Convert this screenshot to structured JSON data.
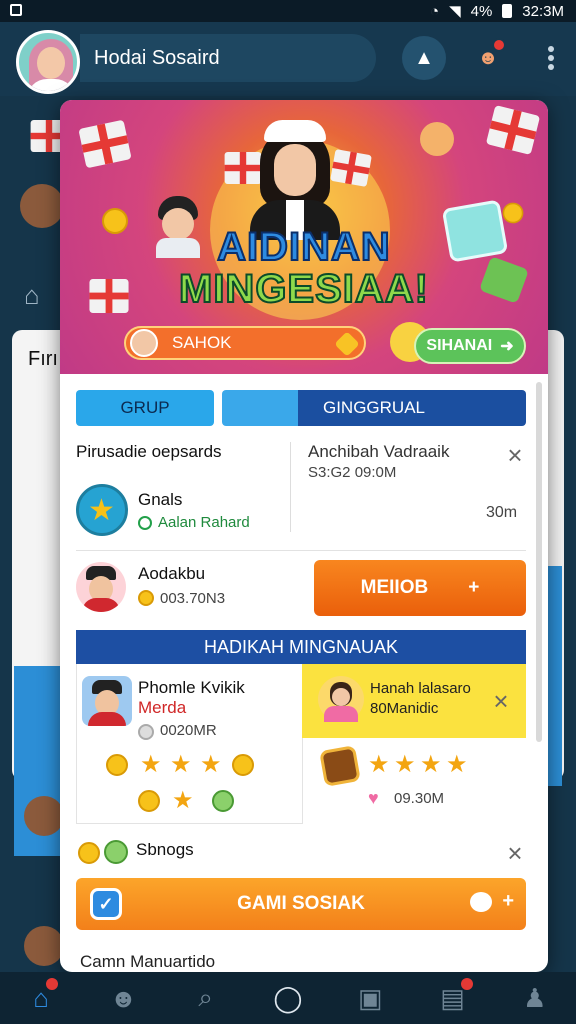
{
  "status_bar": {
    "battery": "4%",
    "time": "32:3M"
  },
  "header": {
    "username": "Hodai Sosaird"
  },
  "background": {
    "card_title": "Fırı"
  },
  "banner": {
    "title_line1": "AIDINAN",
    "title_line2": "MINGESIAA!",
    "pill_label": "SAHOK",
    "button_label": "SIHANAI"
  },
  "tabs": [
    {
      "label": "GRUP"
    },
    {
      "label": "GINGGRUAL"
    }
  ],
  "list": {
    "item1": {
      "title": "Pirusadie oepsards",
      "right_title": "Anchibah Vadraaik",
      "right_sub": "S3:G2 09:0M"
    },
    "item2": {
      "title": "Gnals",
      "sub": "Aalan Rahard",
      "time": "30m"
    },
    "item3": {
      "title": "Aodakbu",
      "sub": "003.70N3",
      "button_label": "MEIIOB",
      "button_icon": "+"
    }
  },
  "gift_section": {
    "header": "HADIKAH MINGNAUAK",
    "left": {
      "title_line1": "Phomle Kvikik",
      "title_line2": "Merda",
      "sub": "0020MR"
    },
    "right": {
      "title_line1": "Hanah lalasaro",
      "title_line2": "80Manidic",
      "sub": "09.30M"
    }
  },
  "bottom": {
    "row_label": "Sbnogs",
    "main_button": "GAMI SOSIAK",
    "footer_text": "Camn Manuartido"
  },
  "colors": {
    "accent": "#2e8be0",
    "orange": "#f3801a",
    "header_blue": "#1d4fa3"
  },
  "nav": [
    {
      "icon": "home-icon",
      "active": true
    },
    {
      "icon": "user-icon"
    },
    {
      "icon": "search-icon"
    },
    {
      "icon": "circle-icon"
    },
    {
      "icon": "chart-icon"
    },
    {
      "icon": "inbox-icon"
    },
    {
      "icon": "profile-icon"
    }
  ]
}
